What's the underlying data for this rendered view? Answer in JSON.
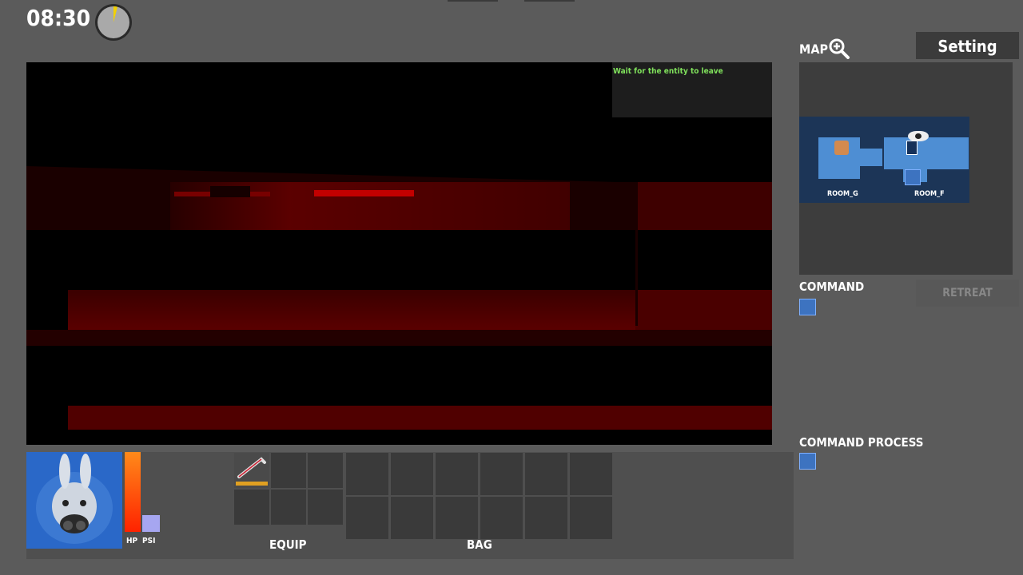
{
  "clock": {
    "time": "08:30",
    "dial_progress": 0.06,
    "dial_icon": "clock-dial-icon"
  },
  "viewport": {
    "objective": "Wait for the entity to leave"
  },
  "map": {
    "label": "MAP",
    "zoom_icon": "zoom-in-icon",
    "rooms": [
      {
        "name": "ROOM_G",
        "marker_icon": "bear-plush-icon"
      },
      {
        "name": "ROOM_F",
        "marker_icon": "watcher-eye-icon"
      }
    ]
  },
  "settings": {
    "label": "Setting"
  },
  "command": {
    "label": "COMMAND",
    "retreat_label": "RETREAT",
    "agent_icon": "agent-rabbit-icon"
  },
  "command_process": {
    "label": "COMMAND PROCESS",
    "agent_icon": "agent-rabbit-icon"
  },
  "status": {
    "hp_label": "HP",
    "psi_label": "PSI",
    "hp_fraction": 1.0,
    "psi_fraction": 0.21,
    "hp_color": "#ff5500",
    "psi_color": "#a6a6f0"
  },
  "inventory": {
    "equip_label": "EQUIP",
    "bag_label": "BAG",
    "equipped_item_icon": "crowbar-icon"
  },
  "colors": {
    "background": "#5b5b5b",
    "objective_text": "#7fe05b",
    "room_fill": "#4e8ed3"
  }
}
